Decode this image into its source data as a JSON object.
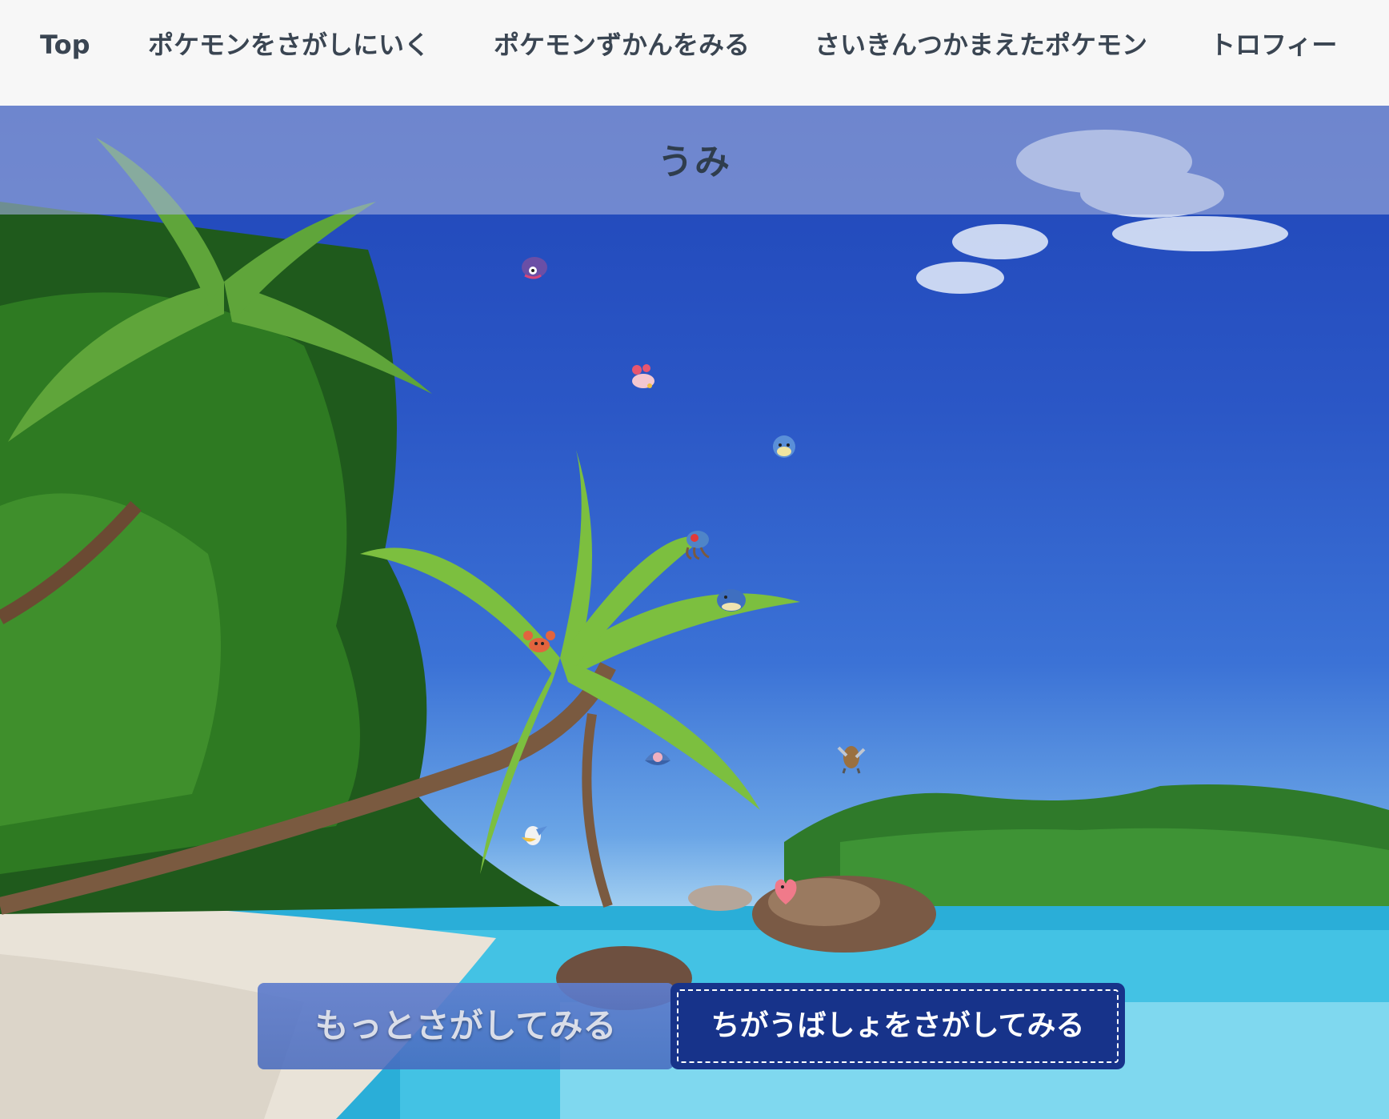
{
  "nav": {
    "items": [
      {
        "label": "Top"
      },
      {
        "label": "ポケモンをさがしにいく"
      },
      {
        "label": "ポケモンずかんをみる"
      },
      {
        "label": "さいきんつかまえたポケモン"
      },
      {
        "label": "トロフィー"
      }
    ]
  },
  "scene": {
    "title": "うみ",
    "pokemon_icons": [
      "shellder-icon",
      "corsola-icon",
      "spheal-icon",
      "tentacruel-icon",
      "wailmer-icon",
      "krabby-icon",
      "clamperl-icon",
      "kabutops-icon",
      "pelipper-icon",
      "luvdisc-icon"
    ]
  },
  "buttons": {
    "search_more": "もっとさがしてみる",
    "search_elsewhere": "ちがうばしょをさがしてみる"
  },
  "colors": {
    "nav_bg": "#f7f7f7",
    "nav_text": "#3a4552",
    "primary_button": "#17338a",
    "secondary_button": "#5f7dcd"
  }
}
